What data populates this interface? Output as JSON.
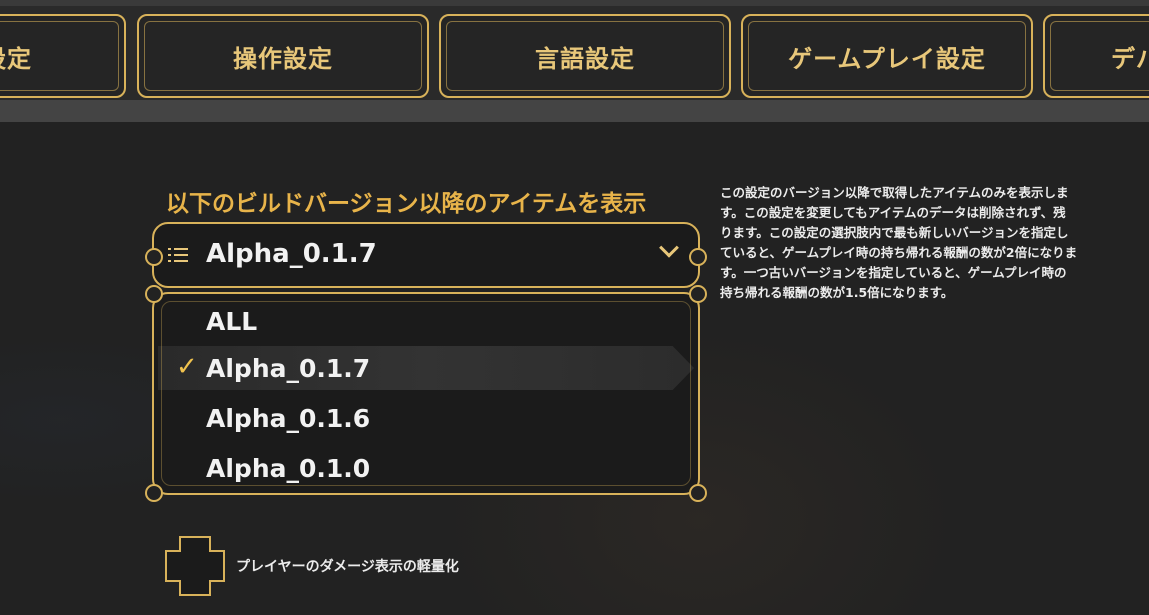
{
  "tabs": [
    {
      "label": "設定"
    },
    {
      "label": "操作設定"
    },
    {
      "label": "言語設定"
    },
    {
      "label": "ゲームプレイ設定"
    },
    {
      "label": "デバ"
    }
  ],
  "build_version": {
    "label": "以下のビルドバージョン以降のアイテムを表示",
    "selected": "Alpha_0.1.7",
    "options": [
      {
        "label": "ALL"
      },
      {
        "label": "Alpha_0.1.7"
      },
      {
        "label": "Alpha_0.1.6"
      },
      {
        "label": "Alpha_0.1.0"
      }
    ],
    "check_mark": "✓"
  },
  "description": {
    "lines": [
      "この設定のバージョン以降で取得したアイテムのみを表示しま",
      "す。この設定を変更してもアイテムのデータは削除されず、残",
      "ります。この設定の選択肢内で最も新しいバージョンを指定し",
      "ていると、ゲームプレイ時の持ち帰れる報酬の数が2倍になりま",
      "す。一つ古いバージョンを指定していると、ゲームプレイ時の",
      "持ち帰れる報酬の数が1.5倍になります。"
    ]
  },
  "damage_display": {
    "label": "プレイヤーのダメージ表示の軽量化"
  },
  "colors": {
    "accent_gold": "#d8b25a",
    "label_gold": "#e8b44a",
    "background": "#222222"
  },
  "icons": {
    "list": "list-icon",
    "dropdown": "chevron-down-icon",
    "selected": "check-icon"
  }
}
